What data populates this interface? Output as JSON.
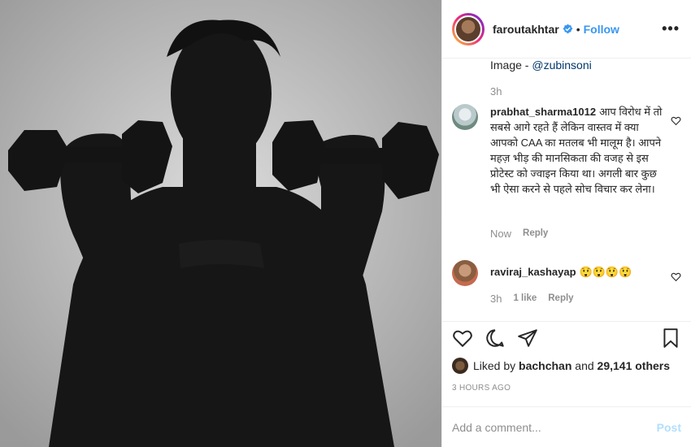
{
  "post": {
    "image_alt": "Silhouette of man lifting two dumbbells",
    "username": "faroutakhtar",
    "follow_label": "Follow",
    "more_label": "•••",
    "separator": "•"
  },
  "previous_comment": {
    "text_prefix": "Image - ",
    "mention": "@zubinsoni",
    "time": "3h"
  },
  "comments": [
    {
      "user": "prabhat_sharma1012",
      "text": "आप विरोध में तो सबसे आगे रहते हैं लेकिन वास्तव में क्या आपको CAA का मतलब भी मालूम है। आपने महज़ भीड़ की मानसिकता की वजह से इस प्रोटेस्ट को ज्वाइन किया था। अगली बार कुछ भी ऐसा करने से पहले सोच विचार कर लेना।",
      "time": "Now",
      "reply_label": "Reply"
    },
    {
      "user": "raviraj_kashayap",
      "text": "😲😲😲😲",
      "time": "3h",
      "likes_label": "1 like",
      "reply_label": "Reply"
    }
  ],
  "likes": {
    "prefix": "Liked by ",
    "liker": "bachchan",
    "middle": " and ",
    "count": "29,141 others"
  },
  "timestamp": "3 HOURS AGO",
  "add_comment": {
    "placeholder": "Add a comment...",
    "post_label": "Post"
  },
  "icons": {
    "verified": "verified-badge-icon",
    "like": "heart-icon",
    "comment": "comment-bubble-icon",
    "share": "paper-plane-icon",
    "save": "bookmark-icon"
  },
  "colors": {
    "accent": "#3897f0",
    "post_disabled": "#b2dffc",
    "meta": "#8e8e8e"
  }
}
